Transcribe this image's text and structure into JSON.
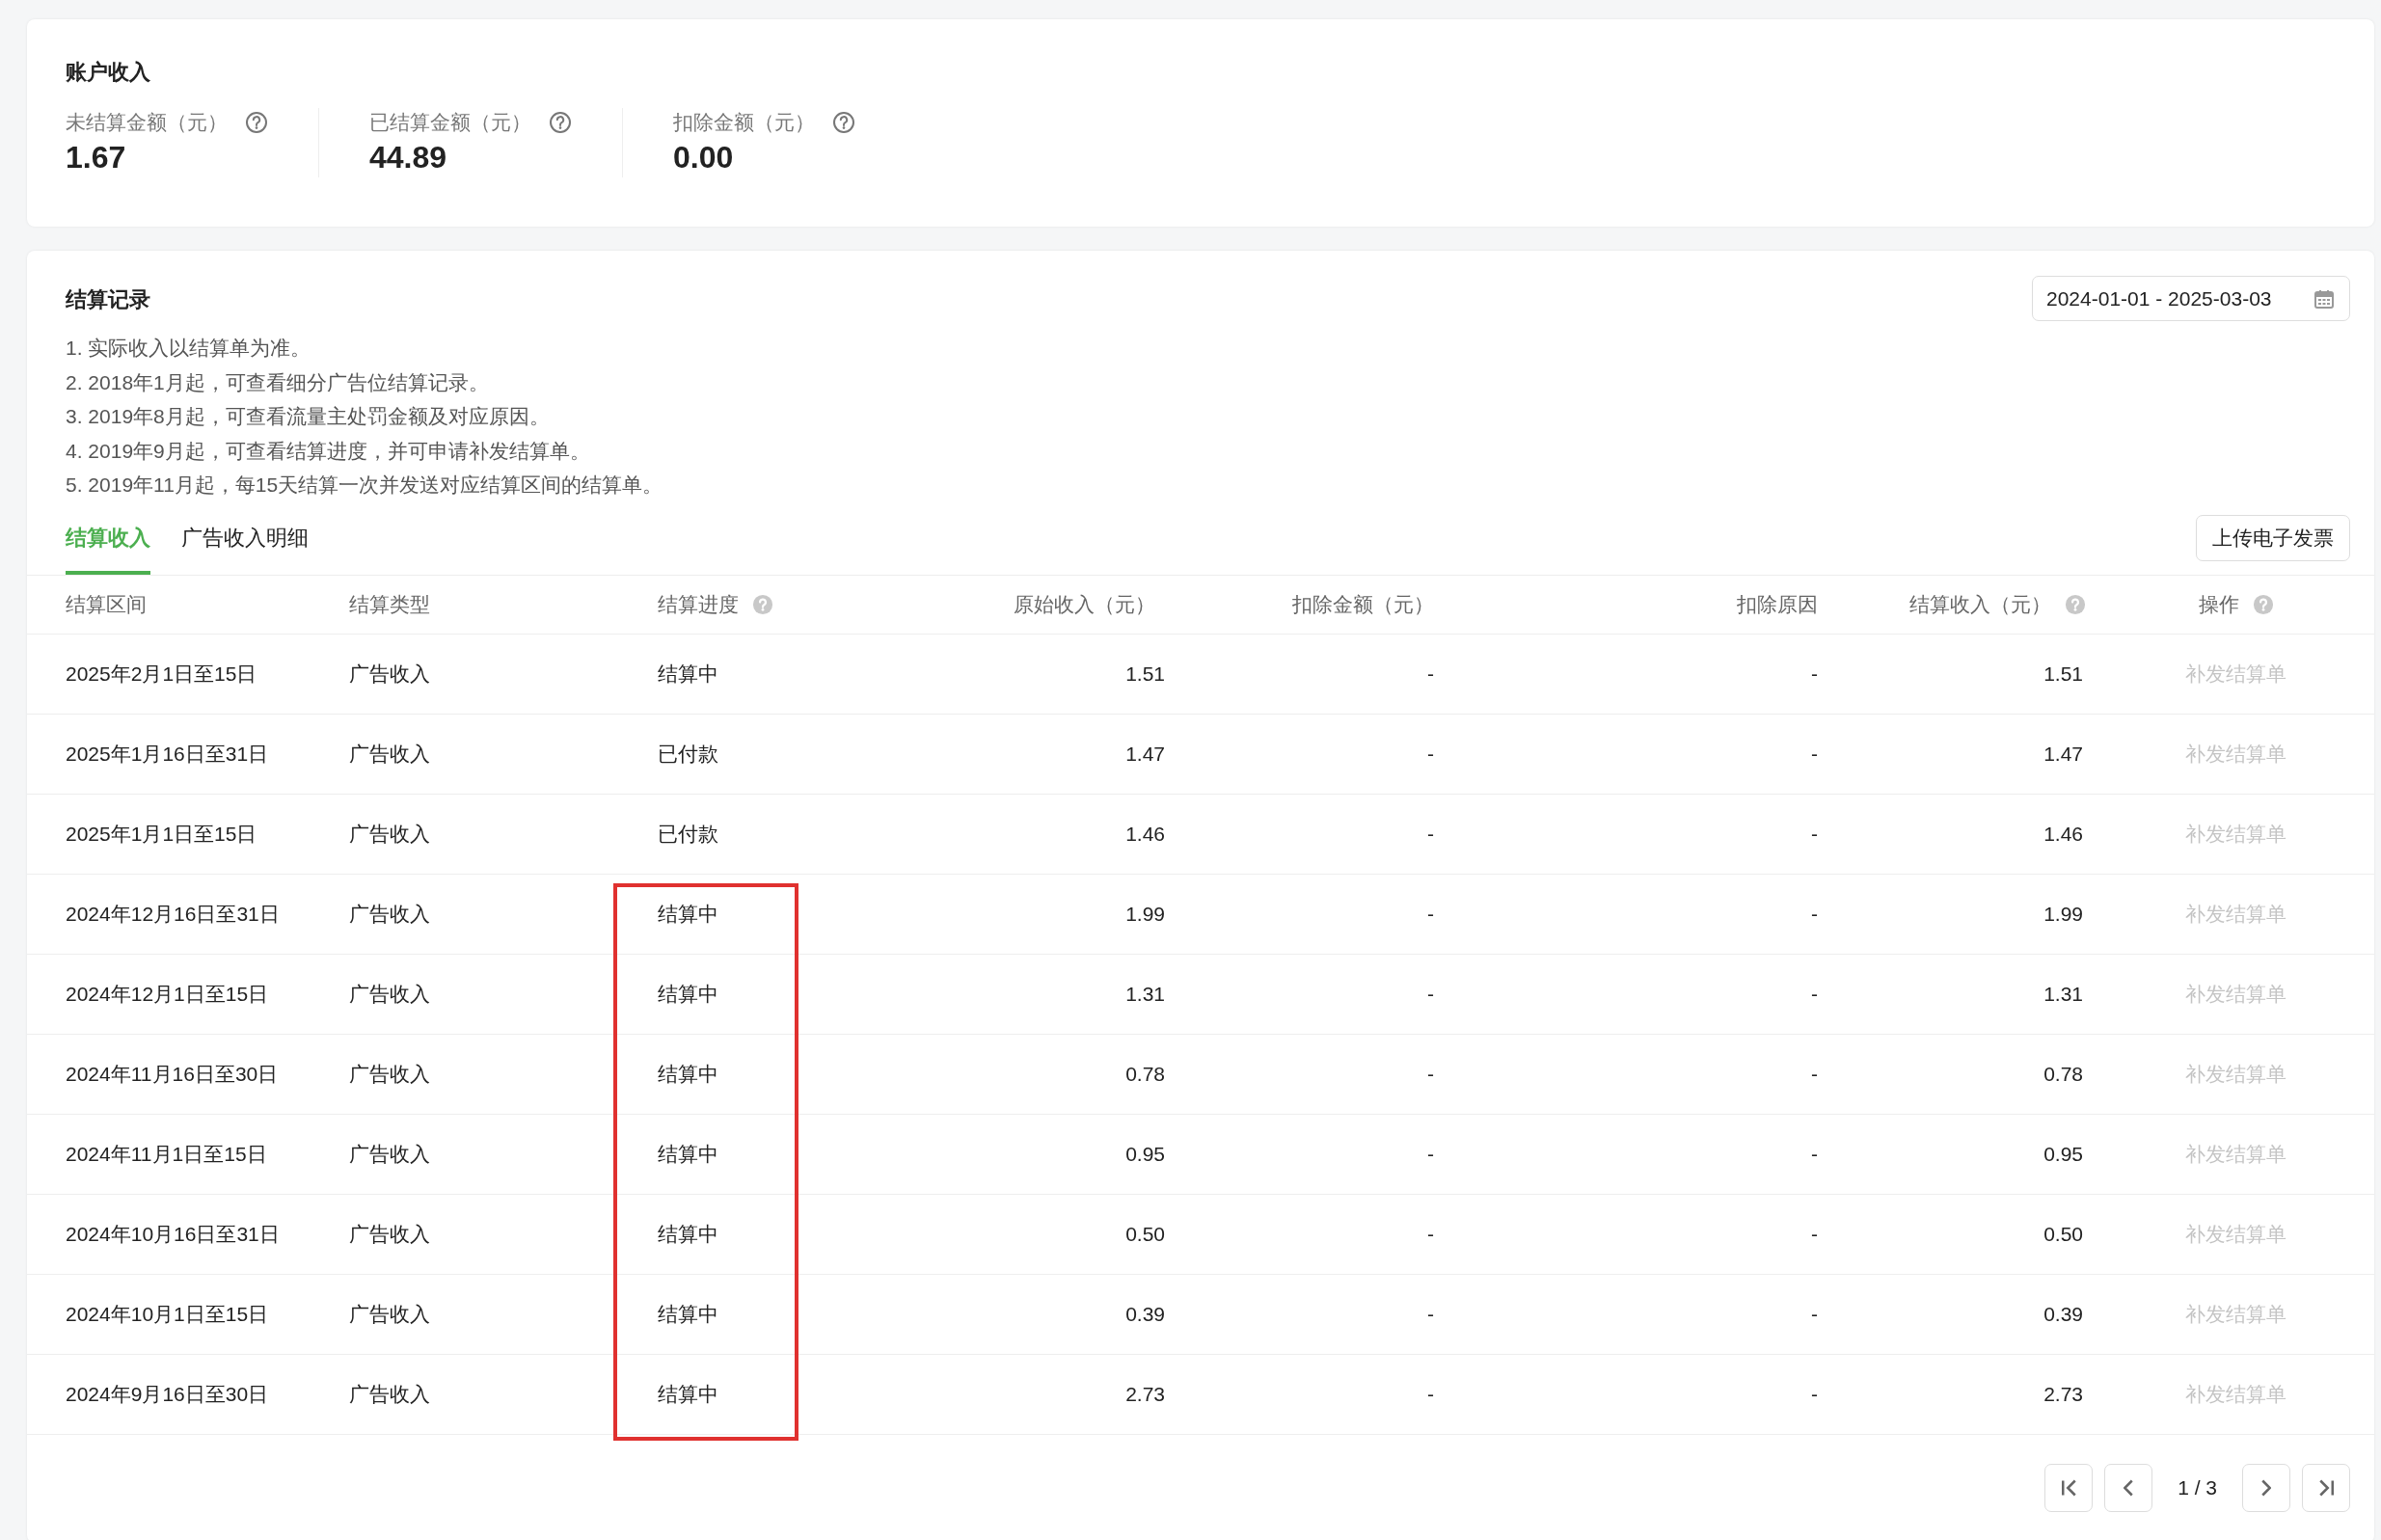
{
  "account_income": {
    "title": "账户收入",
    "stats": [
      {
        "label": "未结算金额（元）",
        "value": "1.67",
        "help": true
      },
      {
        "label": "已结算金额（元）",
        "value": "44.89",
        "help": true
      },
      {
        "label": "扣除金额（元）",
        "value": "0.00",
        "help": true
      }
    ]
  },
  "settlement": {
    "title": "结算记录",
    "notes": [
      "1. 实际收入以结算单为准。",
      "2. 2018年1月起，可查看细分广告位结算记录。",
      "3. 2019年8月起，可查看流量主处罚金额及对应原因。",
      "4. 2019年9月起，可查看结算进度，并可申请补发结算单。",
      "5. 2019年11月起，每15天结算一次并发送对应结算区间的结算单。"
    ],
    "date_range": "2024-01-01 - 2025-03-03",
    "tabs": [
      {
        "label": "结算收入",
        "selected": true
      },
      {
        "label": "广告收入明细",
        "selected": false
      }
    ],
    "upload_button": "上传电子发票",
    "table": {
      "columns": [
        {
          "label": "结算区间",
          "help": false
        },
        {
          "label": "结算类型",
          "help": false
        },
        {
          "label": "结算进度",
          "help": true
        },
        {
          "label": "原始收入（元）",
          "help": false
        },
        {
          "label": "扣除金额（元）",
          "help": false
        },
        {
          "label": "扣除原因",
          "help": false
        },
        {
          "label": "结算收入（元）",
          "help": true
        },
        {
          "label": "操作",
          "help": true
        }
      ],
      "rows": [
        {
          "cells": [
            "2025年2月1日至15日",
            "广告收入",
            "结算中",
            "1.51",
            "-",
            "-",
            "1.51"
          ],
          "action": {
            "label": "补发结算单",
            "disabled": true
          },
          "highlighted": false
        },
        {
          "cells": [
            "2025年1月16日至31日",
            "广告收入",
            "已付款",
            "1.47",
            "-",
            "-",
            "1.47"
          ],
          "action": {
            "label": "补发结算单",
            "disabled": true
          },
          "highlighted": false
        },
        {
          "cells": [
            "2025年1月1日至15日",
            "广告收入",
            "已付款",
            "1.46",
            "-",
            "-",
            "1.46"
          ],
          "action": {
            "label": "补发结算单",
            "disabled": true
          },
          "highlighted": false
        },
        {
          "cells": [
            "2024年12月16日至31日",
            "广告收入",
            "结算中",
            "1.99",
            "-",
            "-",
            "1.99"
          ],
          "action": {
            "label": "补发结算单",
            "disabled": true
          },
          "highlighted": true
        },
        {
          "cells": [
            "2024年12月1日至15日",
            "广告收入",
            "结算中",
            "1.31",
            "-",
            "-",
            "1.31"
          ],
          "action": {
            "label": "补发结算单",
            "disabled": true
          },
          "highlighted": true
        },
        {
          "cells": [
            "2024年11月16日至30日",
            "广告收入",
            "结算中",
            "0.78",
            "-",
            "-",
            "0.78"
          ],
          "action": {
            "label": "补发结算单",
            "disabled": true
          },
          "highlighted": true
        },
        {
          "cells": [
            "2024年11月1日至15日",
            "广告收入",
            "结算中",
            "0.95",
            "-",
            "-",
            "0.95"
          ],
          "action": {
            "label": "补发结算单",
            "disabled": true
          },
          "highlighted": true
        },
        {
          "cells": [
            "2024年10月16日至31日",
            "广告收入",
            "结算中",
            "0.50",
            "-",
            "-",
            "0.50"
          ],
          "action": {
            "label": "补发结算单",
            "disabled": true
          },
          "highlighted": true
        },
        {
          "cells": [
            "2024年10月1日至15日",
            "广告收入",
            "结算中",
            "0.39",
            "-",
            "-",
            "0.39"
          ],
          "action": {
            "label": "补发结算单",
            "disabled": true
          },
          "highlighted": true
        },
        {
          "cells": [
            "2024年9月16日至30日",
            "广告收入",
            "结算中",
            "2.73",
            "-",
            "-",
            "2.73"
          ],
          "action": {
            "label": "补发结算单",
            "disabled": true
          },
          "highlighted": true
        }
      ]
    },
    "pagination": {
      "page_label": "1 / 3"
    }
  }
}
